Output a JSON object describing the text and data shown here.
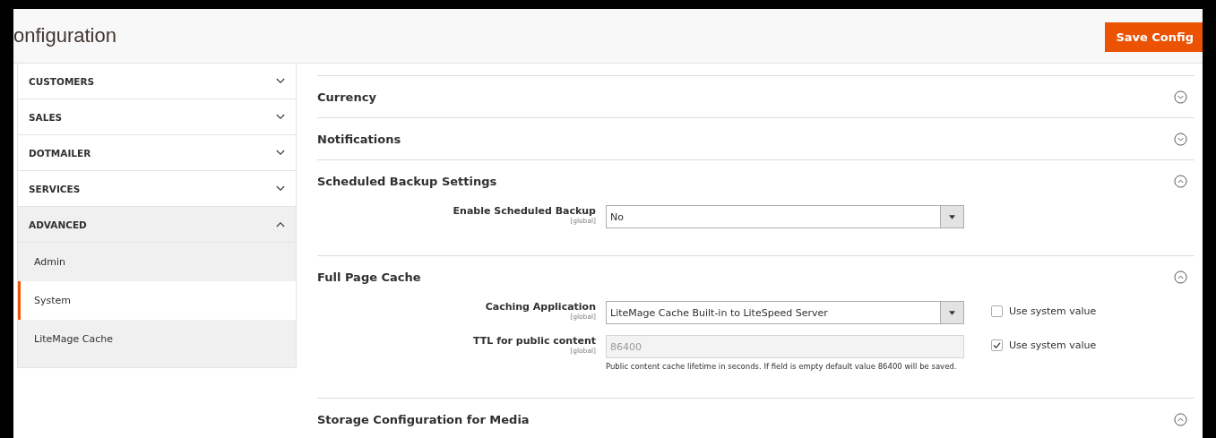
{
  "page": {
    "title": "onfiguration",
    "save_button": "Save Config"
  },
  "sidebar": {
    "items": [
      {
        "label": "CUSTOMERS",
        "expanded": false
      },
      {
        "label": "SALES",
        "expanded": false
      },
      {
        "label": "DOTMAILER",
        "expanded": false
      },
      {
        "label": "SERVICES",
        "expanded": false
      },
      {
        "label": "ADVANCED",
        "expanded": true,
        "children": [
          {
            "label": "Admin",
            "selected": false
          },
          {
            "label": "System",
            "selected": true
          },
          {
            "label": "LiteMage Cache",
            "selected": false
          }
        ]
      }
    ]
  },
  "sections": [
    {
      "title": "Currency",
      "expanded": false
    },
    {
      "title": "Notifications",
      "expanded": false
    },
    {
      "title": "Scheduled Backup Settings",
      "expanded": true,
      "fields": [
        {
          "label": "Enable Scheduled Backup",
          "scope": "[global]",
          "kind": "select",
          "value": "No",
          "disabled": false
        }
      ]
    },
    {
      "title": "Full Page Cache",
      "expanded": true,
      "fields": [
        {
          "label": "Caching Application",
          "scope": "[global]",
          "kind": "select",
          "value": "LiteMage Cache Built-in to LiteSpeed Server",
          "disabled": false,
          "use_system": {
            "label": "Use system value",
            "checked": false
          }
        },
        {
          "label": "TTL for public content",
          "scope": "[global]",
          "kind": "text",
          "value": "86400",
          "disabled": true,
          "note": "Public content cache lifetime in seconds. If field is empty default value 86400 will be saved.",
          "use_system": {
            "label": "Use system value",
            "checked": true
          }
        }
      ]
    },
    {
      "title": "Storage Configuration for Media",
      "expanded": true
    }
  ]
}
